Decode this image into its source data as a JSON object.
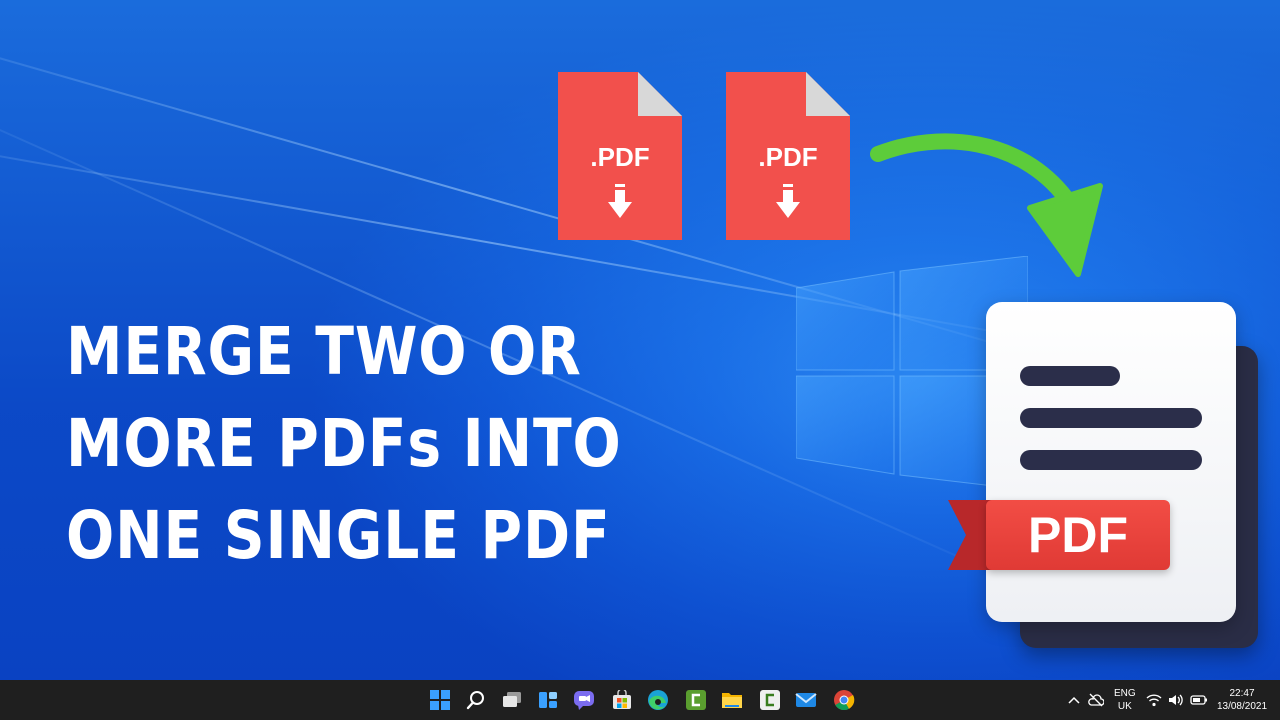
{
  "thumbnail": {
    "headline": [
      "MERGE TWO OR",
      "MORE PDFs INTO",
      "ONE SINGLE PDF"
    ],
    "source_files": [
      {
        "label": ".PDF",
        "color": "#f2504c"
      },
      {
        "label": ".PDF",
        "color": "#f2504c"
      }
    ],
    "output_badge": "PDF",
    "colors": {
      "accent_red": "#e84540",
      "arrow_green": "#5dcc3a",
      "desktop_blue": "#1a6fe8"
    }
  },
  "taskbar": {
    "icons": [
      "windows-start-icon",
      "search-icon",
      "task-view-icon",
      "widgets-icon",
      "teams-chat-icon",
      "store-icon",
      "edge-icon",
      "camtasia-icon",
      "file-explorer-icon",
      "camtasia-recorder-icon",
      "mail-icon",
      "chrome-icon"
    ],
    "language_top": "ENG",
    "language_bottom": "UK",
    "time": "22:47",
    "date": "13/08/2021"
  }
}
